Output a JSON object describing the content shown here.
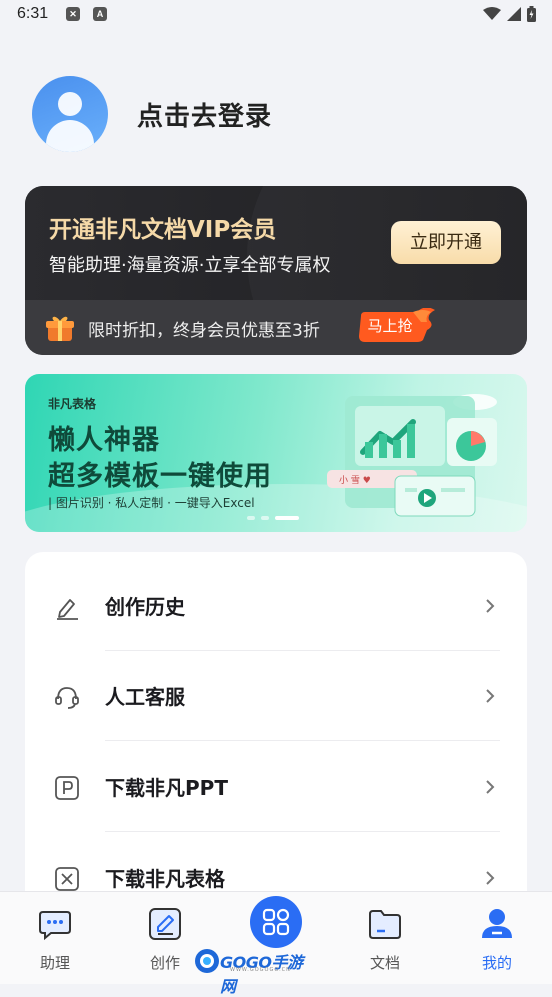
{
  "status_bar": {
    "time": "6:31",
    "icon_a": "A"
  },
  "profile": {
    "login_text": "点击去登录"
  },
  "vip_card": {
    "title": "开通非凡文档VIP会员",
    "subtitle": "智能助理·海量资源·立享全部专属权",
    "open_button": "立即开通",
    "promo_text": "限时折扣，终身会员优惠至3折",
    "grab_button": "马上抢"
  },
  "banner": {
    "brand": "非凡表格",
    "line1": "懒人神器",
    "line2": "超多模板一键使用",
    "tagline": "| 图片识别 · 私人定制 · 一键导入Excel",
    "page_count": 3,
    "active_page": 3,
    "chart_text": "小 雪 ♥"
  },
  "menu": {
    "items": [
      {
        "label": "创作历史",
        "icon": "pencil-icon"
      },
      {
        "label": "人工客服",
        "icon": "headset-icon"
      },
      {
        "label": "下载非凡PPT",
        "icon": "ppt-icon"
      },
      {
        "label": "下载非凡表格",
        "icon": "sheet-icon"
      }
    ]
  },
  "tabs": [
    {
      "label": "助理",
      "icon": "chat-icon"
    },
    {
      "label": "创作",
      "icon": "edit-icon"
    },
    {
      "label": "",
      "icon": "apps-icon"
    },
    {
      "label": "文档",
      "icon": "folder-icon"
    },
    {
      "label": "我的",
      "icon": "user-icon"
    }
  ],
  "watermark": {
    "text": "GOGO",
    "zh": "手游网",
    "sub": "WWW.GOGOGO.CN"
  },
  "colors": {
    "accent": "#2a6df4",
    "vip_gold": "#f5d9a8",
    "banner_green": "#2fd6b4"
  }
}
